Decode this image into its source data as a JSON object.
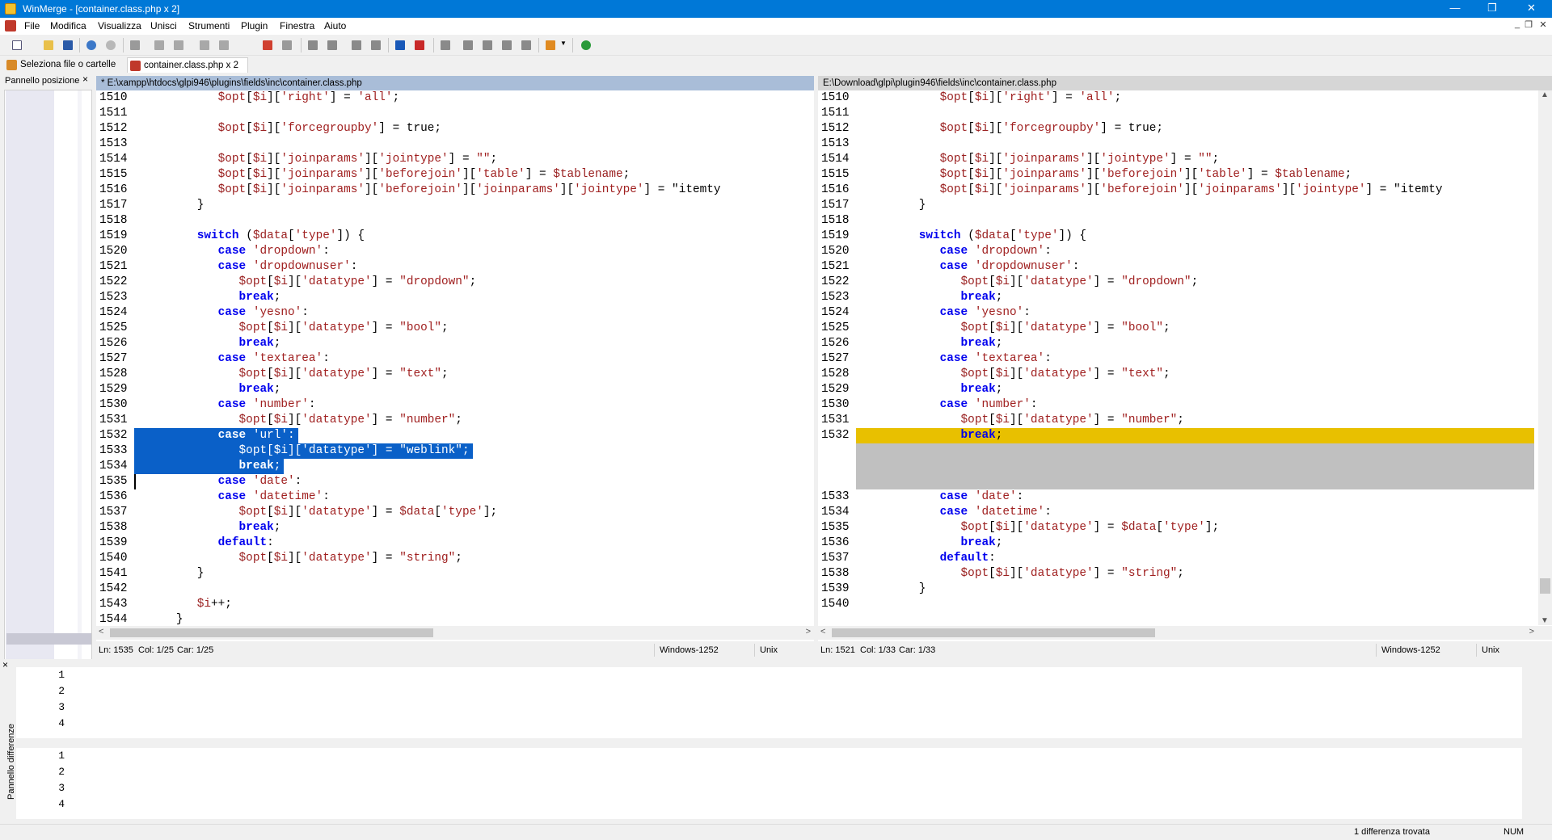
{
  "window": {
    "title": "WinMerge - [container.class.php x 2]",
    "minimize": "—",
    "restore": "❐",
    "close": "✕"
  },
  "menu": [
    "File",
    "Modifica",
    "Visualizza",
    "Unisci",
    "Strumenti",
    "Plugin",
    "Finestra",
    "Aiuto"
  ],
  "mdi": {
    "minimize": "_",
    "restore": "❐",
    "close": "✕"
  },
  "tabs": [
    {
      "label": "Seleziona file o cartelle",
      "icon": "folder-compare-icon"
    },
    {
      "label": "container.class.php x 2",
      "icon": "file-compare-icon"
    }
  ],
  "location_pane": {
    "title": "Pannello posizione",
    "close": "×"
  },
  "left": {
    "path": "* E:\\xampp\\htdocs\\glpi946\\plugins\\fields\\inc\\container.class.php",
    "status": {
      "ln": "Ln: 1535",
      "col": "Col: 1/25",
      "car": "Car: 1/25",
      "encoding": "Windows-1252",
      "eol": "Unix"
    }
  },
  "right": {
    "path": "E:\\Download\\glpi\\plugin946\\fields\\inc\\container.class.php",
    "status": {
      "ln": "Ln: 1521",
      "col": "Col: 1/33",
      "car": "Car: 1/33",
      "encoding": "Windows-1252",
      "eol": "Unix"
    }
  },
  "code_left": [
    {
      "n": "1510",
      "t": "            $opt[$i]['right'] = 'all';"
    },
    {
      "n": "1511",
      "t": ""
    },
    {
      "n": "1512",
      "t": "            $opt[$i]['forcegroupby'] = true;"
    },
    {
      "n": "1513",
      "t": ""
    },
    {
      "n": "1514",
      "t": "            $opt[$i]['joinparams']['jointype'] = \"\";"
    },
    {
      "n": "1515",
      "t": "            $opt[$i]['joinparams']['beforejoin']['table'] = $tablename;"
    },
    {
      "n": "1516",
      "t": "            $opt[$i]['joinparams']['beforejoin']['joinparams']['jointype'] = \"itemty"
    },
    {
      "n": "1517",
      "t": "         }"
    },
    {
      "n": "1518",
      "t": ""
    },
    {
      "n": "1519",
      "t": "         switch ($data['type']) {"
    },
    {
      "n": "1520",
      "t": "            case 'dropdown':"
    },
    {
      "n": "1521",
      "t": "            case 'dropdownuser':"
    },
    {
      "n": "1522",
      "t": "               $opt[$i]['datatype'] = \"dropdown\";"
    },
    {
      "n": "1523",
      "t": "               break;"
    },
    {
      "n": "1524",
      "t": "            case 'yesno':"
    },
    {
      "n": "1525",
      "t": "               $opt[$i]['datatype'] = \"bool\";"
    },
    {
      "n": "1526",
      "t": "               break;"
    },
    {
      "n": "1527",
      "t": "            case 'textarea':"
    },
    {
      "n": "1528",
      "t": "               $opt[$i]['datatype'] = \"text\";"
    },
    {
      "n": "1529",
      "t": "               break;"
    },
    {
      "n": "1530",
      "t": "            case 'number':"
    },
    {
      "n": "1531",
      "t": "               $opt[$i]['datatype'] = \"number\";"
    },
    {
      "n": "1532",
      "t": "            case 'url':"
    },
    {
      "n": "1533",
      "t": "               $opt[$i]['datatype'] = \"weblink\";"
    },
    {
      "n": "1534",
      "t": "               break;"
    },
    {
      "n": "1535",
      "t": "            case 'date':"
    },
    {
      "n": "1536",
      "t": "            case 'datetime':"
    },
    {
      "n": "1537",
      "t": "               $opt[$i]['datatype'] = $data['type'];"
    },
    {
      "n": "1538",
      "t": "               break;"
    },
    {
      "n": "1539",
      "t": "            default:"
    },
    {
      "n": "1540",
      "t": "               $opt[$i]['datatype'] = \"string\";"
    },
    {
      "n": "1541",
      "t": "         }"
    },
    {
      "n": "1542",
      "t": ""
    },
    {
      "n": "1543",
      "t": "         $i++;"
    },
    {
      "n": "1544",
      "t": "      }"
    }
  ],
  "code_right": [
    {
      "n": "1510",
      "t": "            $opt[$i]['right'] = 'all';"
    },
    {
      "n": "1511",
      "t": ""
    },
    {
      "n": "1512",
      "t": "            $opt[$i]['forcegroupby'] = true;"
    },
    {
      "n": "1513",
      "t": ""
    },
    {
      "n": "1514",
      "t": "            $opt[$i]['joinparams']['jointype'] = \"\";"
    },
    {
      "n": "1515",
      "t": "            $opt[$i]['joinparams']['beforejoin']['table'] = $tablename;"
    },
    {
      "n": "1516",
      "t": "            $opt[$i]['joinparams']['beforejoin']['joinparams']['jointype'] = \"itemty"
    },
    {
      "n": "1517",
      "t": "         }"
    },
    {
      "n": "1518",
      "t": ""
    },
    {
      "n": "1519",
      "t": "         switch ($data['type']) {"
    },
    {
      "n": "1520",
      "t": "            case 'dropdown':"
    },
    {
      "n": "1521",
      "t": "            case 'dropdownuser':"
    },
    {
      "n": "1522",
      "t": "               $opt[$i]['datatype'] = \"dropdown\";"
    },
    {
      "n": "1523",
      "t": "               break;"
    },
    {
      "n": "1524",
      "t": "            case 'yesno':"
    },
    {
      "n": "1525",
      "t": "               $opt[$i]['datatype'] = \"bool\";"
    },
    {
      "n": "1526",
      "t": "               break;"
    },
    {
      "n": "1527",
      "t": "            case 'textarea':"
    },
    {
      "n": "1528",
      "t": "               $opt[$i]['datatype'] = \"text\";"
    },
    {
      "n": "1529",
      "t": "               break;"
    },
    {
      "n": "1530",
      "t": "            case 'number':"
    },
    {
      "n": "1531",
      "t": "               $opt[$i]['datatype'] = \"number\";"
    },
    {
      "n": "1532",
      "t": "               break;"
    },
    {
      "n": "",
      "t": ""
    },
    {
      "n": "",
      "t": ""
    },
    {
      "n": "",
      "t": ""
    },
    {
      "n": "1533",
      "t": "            case 'date':"
    },
    {
      "n": "1534",
      "t": "            case 'datetime':"
    },
    {
      "n": "1535",
      "t": "               $opt[$i]['datatype'] = $data['type'];"
    },
    {
      "n": "1536",
      "t": "               break;"
    },
    {
      "n": "1537",
      "t": "            default:"
    },
    {
      "n": "1538",
      "t": "               $opt[$i]['datatype'] = \"string\";"
    },
    {
      "n": "1539",
      "t": "         }"
    },
    {
      "n": "1540",
      "t": ""
    }
  ],
  "diff_pane": {
    "title": "Pannello differenze",
    "top_lines": [
      "1",
      "2",
      "3",
      "4"
    ],
    "bottom_lines": [
      "1",
      "2",
      "3",
      "4"
    ],
    "close": "×"
  },
  "statusbar": {
    "message": "1 differenza trovata",
    "num": "NUM"
  },
  "colors": {
    "selection": "#0a60c8",
    "diff_highlight": "#e8c000",
    "gap": "#c0c0c0",
    "keyword": "#0000ee",
    "string": "#a02020"
  }
}
